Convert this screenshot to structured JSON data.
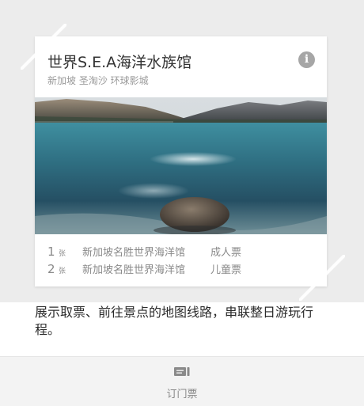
{
  "card": {
    "title": "世界S.E.A海洋水族馆",
    "subtitle": "新加坡 圣淘沙 环球影城",
    "info_icon": "info-icon",
    "photo_description_icon": "lake-mountain-photo",
    "tickets": [
      {
        "count": "1",
        "unit": "张",
        "name": "新加坡名胜世界海洋馆",
        "type": "成人票"
      },
      {
        "count": "2",
        "unit": "张",
        "name": "新加坡名胜世界海洋馆",
        "type": "儿童票"
      }
    ]
  },
  "description": "展示取票、前往景点的地图线路，串联整日游玩行程。",
  "bottom_nav": {
    "icon": "ticket-icon",
    "label": "订门票"
  },
  "colors": {
    "background_band": "#ececec",
    "card": "#ffffff",
    "title_text": "#333333",
    "muted_text": "#8a8a8a",
    "bottom_bar": "#f3f3f3"
  }
}
